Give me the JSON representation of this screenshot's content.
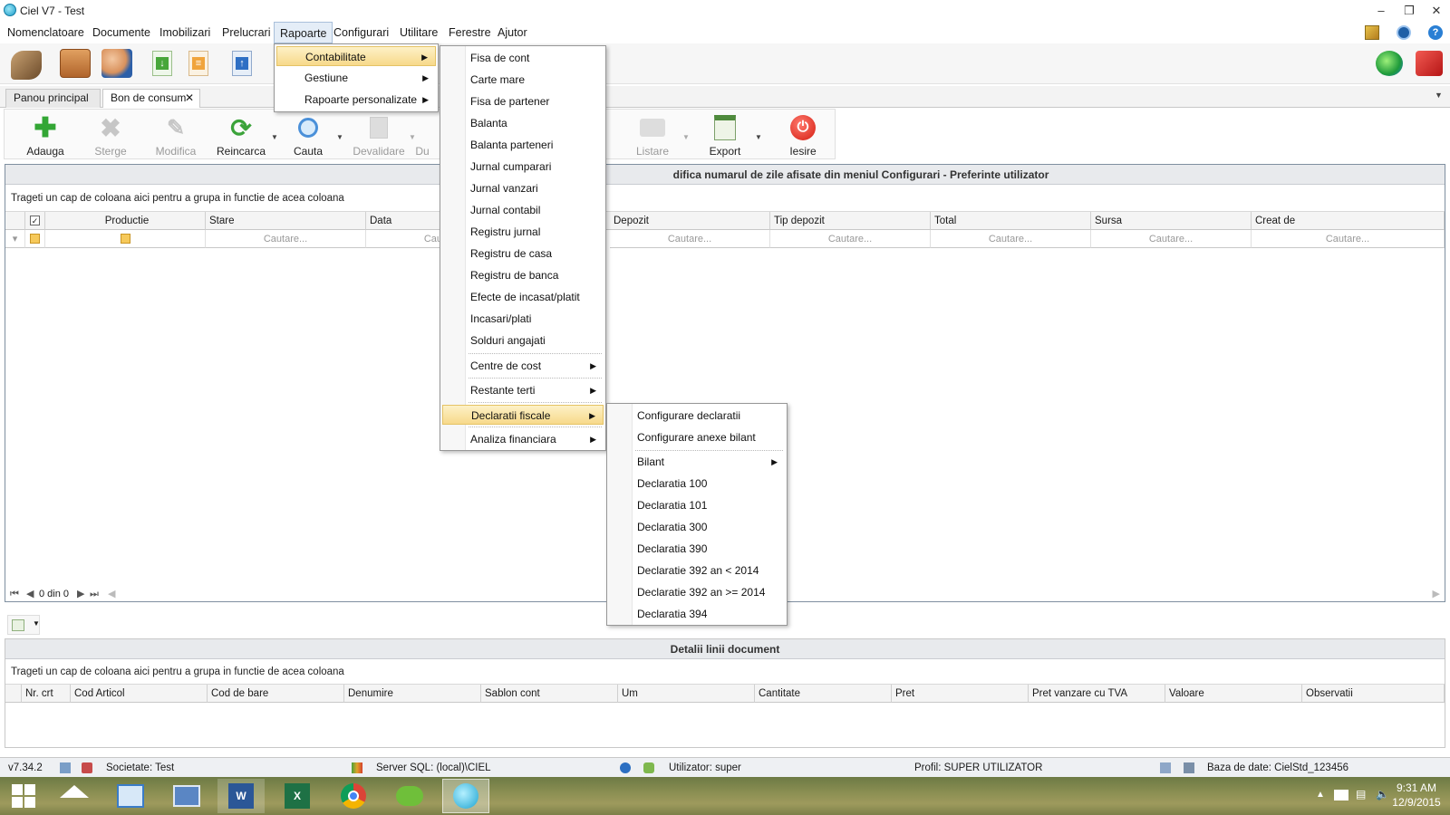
{
  "window": {
    "title": "Ciel V7 - Test"
  },
  "menubar": [
    "Nomenclatoare",
    "Documente",
    "Imobilizari",
    "Prelucrari",
    "Rapoarte",
    "Configurari",
    "Utilitare",
    "Ferestre",
    "Ajutor"
  ],
  "tabs": [
    "Panou principal",
    "Bon de consum"
  ],
  "toolbar": [
    {
      "label": "Adauga",
      "enabled": true
    },
    {
      "label": "Sterge",
      "enabled": false
    },
    {
      "label": "Modifica",
      "enabled": false
    },
    {
      "label": "Reincarca",
      "enabled": true
    },
    {
      "label": "Cauta",
      "enabled": true
    },
    {
      "label": "Devalidare",
      "enabled": false
    },
    {
      "label": "Du",
      "enabled": false
    },
    {
      "label": "Listare",
      "enabled": false
    },
    {
      "label": "Export",
      "enabled": true
    },
    {
      "label": "Iesire",
      "enabled": true
    }
  ],
  "grid": {
    "info": "difica numarul de zile afisate din meniul Configurari - Preferinte utilizator",
    "group_hint": "Trageti un cap de coloana aici pentru a grupa in functie de acea coloana",
    "columns": [
      "Productie",
      "Stare",
      "Data",
      "",
      "Depozit",
      "Tip depozit",
      "Total",
      "Sursa",
      "Creat de"
    ],
    "search_placeholder": "Cautare..."
  },
  "pager": {
    "text": "0 din 0"
  },
  "details": {
    "title": "Detalii linii document",
    "group_hint": "Trageti un cap de coloana aici pentru a grupa in functie de acea coloana",
    "columns": [
      "Nr. crt",
      "Cod Articol",
      "Cod de bare",
      "Denumire",
      "Sablon cont",
      "Um",
      "Cantitate",
      "Pret",
      "Pret vanzare cu TVA",
      "Valoare",
      "Observatii"
    ]
  },
  "menu_rapoarte": [
    {
      "label": "Contabilitate",
      "submenu": true,
      "highlighted": true
    },
    {
      "label": "Gestiune",
      "submenu": true
    },
    {
      "label": "Rapoarte personalizate",
      "submenu": true
    }
  ],
  "menu_contabilitate": [
    {
      "label": "Fisa de cont"
    },
    {
      "label": "Carte mare"
    },
    {
      "label": "Fisa de partener"
    },
    {
      "label": "Balanta"
    },
    {
      "label": "Balanta parteneri"
    },
    {
      "label": "Jurnal cumparari"
    },
    {
      "label": "Jurnal vanzari"
    },
    {
      "label": "Jurnal contabil"
    },
    {
      "label": "Registru jurnal"
    },
    {
      "label": "Registru de casa"
    },
    {
      "label": "Registru de banca"
    },
    {
      "label": "Efecte de incasat/platit"
    },
    {
      "label": "Incasari/plati"
    },
    {
      "label": "Solduri angajati"
    },
    {
      "label": "Centre de cost",
      "submenu": true
    },
    {
      "label": "Restante terti",
      "submenu": true
    },
    {
      "label": "Declaratii fiscale",
      "submenu": true,
      "highlighted": true
    },
    {
      "label": "Analiza financiara",
      "submenu": true
    }
  ],
  "menu_declaratii": [
    {
      "label": "Configurare declaratii"
    },
    {
      "label": "Configurare anexe bilant"
    },
    {
      "label": "Bilant",
      "submenu": true
    },
    {
      "label": "Declaratia 100"
    },
    {
      "label": "Declaratia 101"
    },
    {
      "label": "Declaratia 300"
    },
    {
      "label": "Declaratia 390"
    },
    {
      "label": "Declaratie 392 an < 2014"
    },
    {
      "label": "Declaratie 392 an >= 2014"
    },
    {
      "label": "Declaratia 394"
    }
  ],
  "status": {
    "version": "v7.34.2",
    "company": "Societate: Test",
    "server": "Server SQL: (local)\\CIEL",
    "user": "Utilizator: super",
    "profile": "Profil: SUPER UTILIZATOR",
    "database": "Baza de date: CielStd_123456"
  },
  "clock": {
    "time": "9:31 AM",
    "date": "12/9/2015"
  }
}
